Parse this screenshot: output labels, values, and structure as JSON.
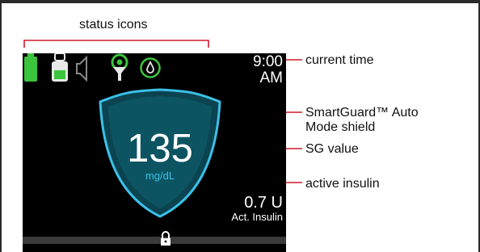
{
  "callouts": {
    "status_icons": "status icons",
    "current_time": "current time",
    "shield_line1": "SmartGuard™ Auto",
    "shield_line2": "Mode shield",
    "sg_value": "SG value",
    "active_insulin": "active insulin"
  },
  "screen": {
    "time_hour": "9:00",
    "time_period": "AM",
    "sg_value": "135",
    "sg_unit": "mg/dL",
    "insulin_value": "0.7 U",
    "insulin_label": "Act. Insulin",
    "icons": [
      "battery-icon",
      "reservoir-icon",
      "speaker-icon",
      "sensor-signal-icon",
      "calibration-drop-icon",
      "lock-icon"
    ]
  },
  "colors": {
    "battery_green": "#3cc43c",
    "shield_cyan": "#3cc0e8",
    "callout_red": "#d0182a"
  }
}
